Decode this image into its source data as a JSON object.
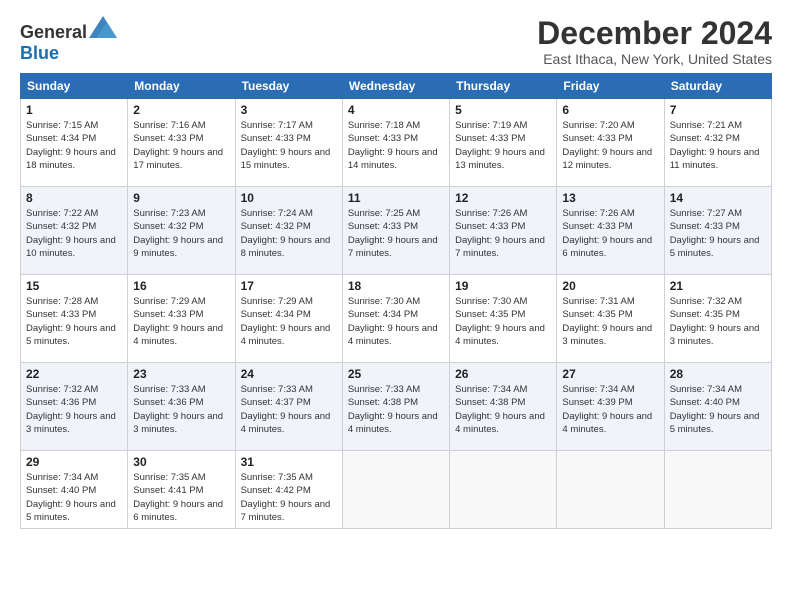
{
  "header": {
    "logo_general": "General",
    "logo_blue": "Blue",
    "month_title": "December 2024",
    "location": "East Ithaca, New York, United States"
  },
  "weekdays": [
    "Sunday",
    "Monday",
    "Tuesday",
    "Wednesday",
    "Thursday",
    "Friday",
    "Saturday"
  ],
  "weeks": [
    [
      {
        "day": "1",
        "sunrise": "7:15 AM",
        "sunset": "4:34 PM",
        "daylight": "9 hours and 18 minutes."
      },
      {
        "day": "2",
        "sunrise": "7:16 AM",
        "sunset": "4:33 PM",
        "daylight": "9 hours and 17 minutes."
      },
      {
        "day": "3",
        "sunrise": "7:17 AM",
        "sunset": "4:33 PM",
        "daylight": "9 hours and 15 minutes."
      },
      {
        "day": "4",
        "sunrise": "7:18 AM",
        "sunset": "4:33 PM",
        "daylight": "9 hours and 14 minutes."
      },
      {
        "day": "5",
        "sunrise": "7:19 AM",
        "sunset": "4:33 PM",
        "daylight": "9 hours and 13 minutes."
      },
      {
        "day": "6",
        "sunrise": "7:20 AM",
        "sunset": "4:33 PM",
        "daylight": "9 hours and 12 minutes."
      },
      {
        "day": "7",
        "sunrise": "7:21 AM",
        "sunset": "4:32 PM",
        "daylight": "9 hours and 11 minutes."
      }
    ],
    [
      {
        "day": "8",
        "sunrise": "7:22 AM",
        "sunset": "4:32 PM",
        "daylight": "9 hours and 10 minutes."
      },
      {
        "day": "9",
        "sunrise": "7:23 AM",
        "sunset": "4:32 PM",
        "daylight": "9 hours and 9 minutes."
      },
      {
        "day": "10",
        "sunrise": "7:24 AM",
        "sunset": "4:32 PM",
        "daylight": "9 hours and 8 minutes."
      },
      {
        "day": "11",
        "sunrise": "7:25 AM",
        "sunset": "4:33 PM",
        "daylight": "9 hours and 7 minutes."
      },
      {
        "day": "12",
        "sunrise": "7:26 AM",
        "sunset": "4:33 PM",
        "daylight": "9 hours and 7 minutes."
      },
      {
        "day": "13",
        "sunrise": "7:26 AM",
        "sunset": "4:33 PM",
        "daylight": "9 hours and 6 minutes."
      },
      {
        "day": "14",
        "sunrise": "7:27 AM",
        "sunset": "4:33 PM",
        "daylight": "9 hours and 5 minutes."
      }
    ],
    [
      {
        "day": "15",
        "sunrise": "7:28 AM",
        "sunset": "4:33 PM",
        "daylight": "9 hours and 5 minutes."
      },
      {
        "day": "16",
        "sunrise": "7:29 AM",
        "sunset": "4:33 PM",
        "daylight": "9 hours and 4 minutes."
      },
      {
        "day": "17",
        "sunrise": "7:29 AM",
        "sunset": "4:34 PM",
        "daylight": "9 hours and 4 minutes."
      },
      {
        "day": "18",
        "sunrise": "7:30 AM",
        "sunset": "4:34 PM",
        "daylight": "9 hours and 4 minutes."
      },
      {
        "day": "19",
        "sunrise": "7:30 AM",
        "sunset": "4:35 PM",
        "daylight": "9 hours and 4 minutes."
      },
      {
        "day": "20",
        "sunrise": "7:31 AM",
        "sunset": "4:35 PM",
        "daylight": "9 hours and 3 minutes."
      },
      {
        "day": "21",
        "sunrise": "7:32 AM",
        "sunset": "4:35 PM",
        "daylight": "9 hours and 3 minutes."
      }
    ],
    [
      {
        "day": "22",
        "sunrise": "7:32 AM",
        "sunset": "4:36 PM",
        "daylight": "9 hours and 3 minutes."
      },
      {
        "day": "23",
        "sunrise": "7:33 AM",
        "sunset": "4:36 PM",
        "daylight": "9 hours and 3 minutes."
      },
      {
        "day": "24",
        "sunrise": "7:33 AM",
        "sunset": "4:37 PM",
        "daylight": "9 hours and 4 minutes."
      },
      {
        "day": "25",
        "sunrise": "7:33 AM",
        "sunset": "4:38 PM",
        "daylight": "9 hours and 4 minutes."
      },
      {
        "day": "26",
        "sunrise": "7:34 AM",
        "sunset": "4:38 PM",
        "daylight": "9 hours and 4 minutes."
      },
      {
        "day": "27",
        "sunrise": "7:34 AM",
        "sunset": "4:39 PM",
        "daylight": "9 hours and 4 minutes."
      },
      {
        "day": "28",
        "sunrise": "7:34 AM",
        "sunset": "4:40 PM",
        "daylight": "9 hours and 5 minutes."
      }
    ],
    [
      {
        "day": "29",
        "sunrise": "7:34 AM",
        "sunset": "4:40 PM",
        "daylight": "9 hours and 5 minutes."
      },
      {
        "day": "30",
        "sunrise": "7:35 AM",
        "sunset": "4:41 PM",
        "daylight": "9 hours and 6 minutes."
      },
      {
        "day": "31",
        "sunrise": "7:35 AM",
        "sunset": "4:42 PM",
        "daylight": "9 hours and 7 minutes."
      },
      null,
      null,
      null,
      null
    ]
  ]
}
